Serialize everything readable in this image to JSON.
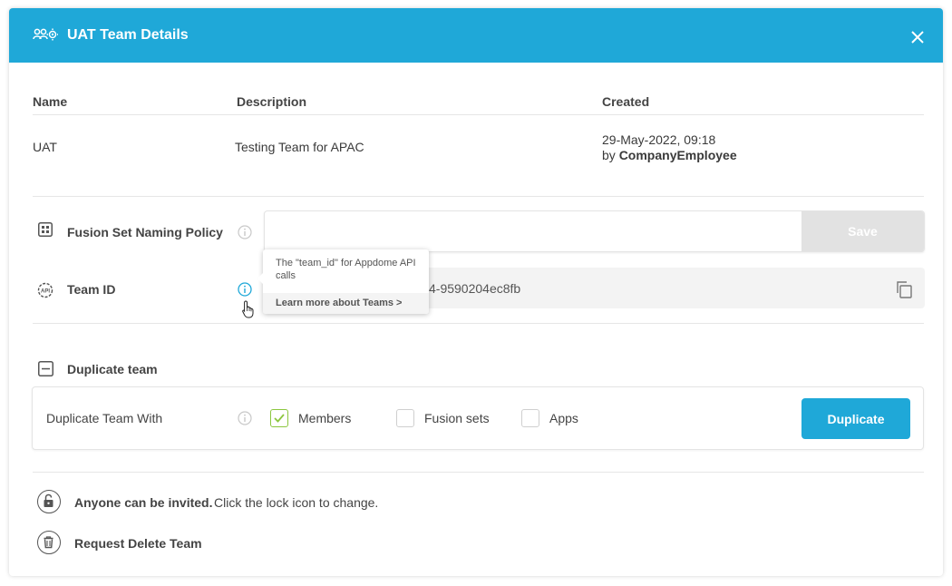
{
  "header": {
    "title": "UAT Team Details",
    "icon": "team-settings-icon",
    "close_icon": "close-icon",
    "bg_color": "#1fa8d8"
  },
  "details_table": {
    "columns": [
      "Name",
      "Description",
      "Created"
    ],
    "row": {
      "name": "UAT",
      "description": "Testing Team for APAC",
      "created_date": "29-May-2022, 09:18",
      "created_by_prefix": "by",
      "created_by": "CompanyEmployee"
    }
  },
  "fusion_policy": {
    "label": "Fusion Set Naming Policy",
    "icon": "grid-icon",
    "input_value": "",
    "save_label": "Save"
  },
  "team_id": {
    "label": "Team ID",
    "icon": "api-icon",
    "value_visible": "4-9590204ec8fb",
    "copy_icon": "copy-icon"
  },
  "tooltip": {
    "text": "The \"team_id\" for Appdome API calls",
    "link": "Learn more about Teams >"
  },
  "duplicate": {
    "section_label": "Duplicate team",
    "with_label": "Duplicate Team With",
    "options": [
      {
        "label": "Members",
        "checked": true
      },
      {
        "label": "Fusion sets",
        "checked": false
      },
      {
        "label": "Apps",
        "checked": false
      }
    ],
    "button_label": "Duplicate"
  },
  "invite": {
    "bold": "Anyone can be invited.",
    "hint": "Click the lock icon to change."
  },
  "delete": {
    "label": "Request Delete Team"
  },
  "colors": {
    "accent": "#1fa8d8",
    "check": "#8cc63f",
    "save_disabled": "#e2e2e2"
  }
}
